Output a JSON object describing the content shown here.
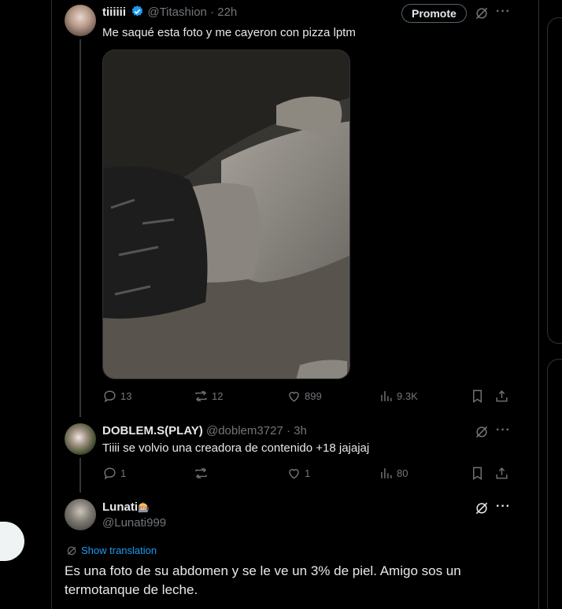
{
  "tweet": {
    "display_name": "tiiiiii",
    "handle": "@Titashion",
    "time": "· 22h",
    "promote_label": "Promote",
    "text": "Me saqué esta foto y me cayeron con pizza lptm",
    "actions": {
      "replies": "13",
      "reposts": "12",
      "likes": "899",
      "views": "9.3K"
    }
  },
  "reply1": {
    "display_name": "DOBLEM.S(PLAY)",
    "handle": "@doblem3727",
    "time": "· 3h",
    "text": "Tiiii se volvio una creadora de contenido +18 jajajaj",
    "actions": {
      "replies": "1",
      "reposts": "",
      "likes": "1",
      "views": "80"
    }
  },
  "reply2": {
    "display_name": "Lunati",
    "name_emoji": "🎰",
    "handle": "@Lunati999",
    "translate_label": "Show translation",
    "text_line1": "Es una foto de su abdomen y se le ve un 3% de piel. Amigo sos un",
    "text_line2": "termotanque de leche."
  },
  "icons": [
    "verified-badge-icon",
    "grok-icon",
    "more-icon",
    "reply-icon",
    "repost-icon",
    "like-icon",
    "views-icon",
    "bookmark-icon",
    "share-icon",
    "translate-icon"
  ],
  "colors": {
    "background": "#000000",
    "text": "#e7e9ea",
    "muted": "#71767b",
    "link": "#1d9bf0",
    "verified": "#1d9bf0",
    "border": "#2f3336"
  }
}
